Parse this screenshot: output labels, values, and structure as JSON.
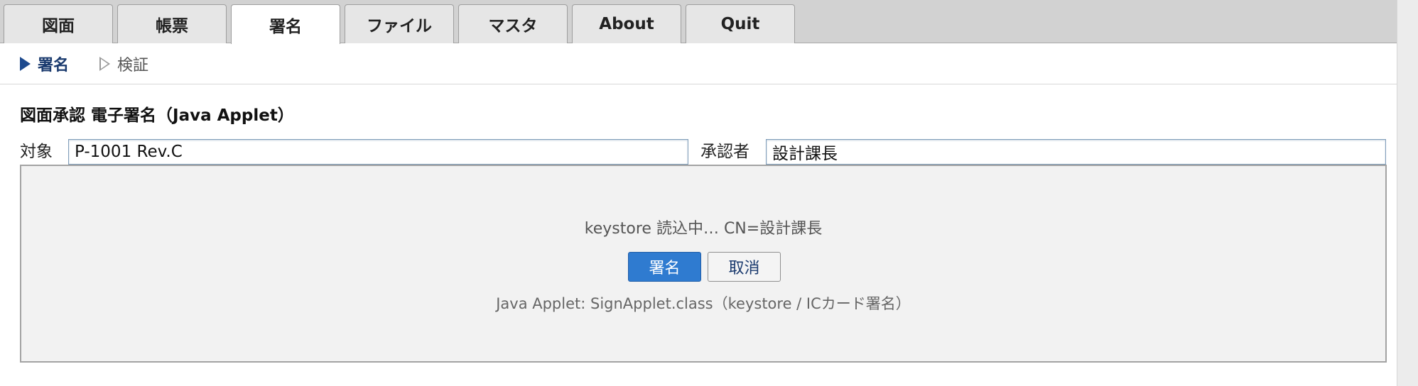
{
  "tabs": [
    {
      "label": "図面",
      "active": false
    },
    {
      "label": "帳票",
      "active": false
    },
    {
      "label": "署名",
      "active": true
    },
    {
      "label": "ファイル",
      "active": false
    },
    {
      "label": "マスタ",
      "active": false
    },
    {
      "label": "About",
      "active": false
    },
    {
      "label": "Quit",
      "active": false
    }
  ],
  "subnav": {
    "items": [
      {
        "label": "署名",
        "active": true
      },
      {
        "label": "検証",
        "active": false
      }
    ]
  },
  "page": {
    "title": "図面承認 電子署名（Java Applet）"
  },
  "form": {
    "target_label": "対象",
    "target_value": "P-1001 Rev.C",
    "approver_label": "承認者",
    "approver_value": "設計課長"
  },
  "applet": {
    "status": "keystore 読込中… CN=設計課長",
    "sign_label": "署名",
    "cancel_label": "取消",
    "caption": "Java Applet: SignApplet.class（keystore / ICカード署名）"
  },
  "colors": {
    "primary_button": "#2f7bd0",
    "active_nav": "#1a3a6e",
    "tabbar_bg": "#d2d2d2",
    "applet_bg": "#f2f2f2"
  }
}
